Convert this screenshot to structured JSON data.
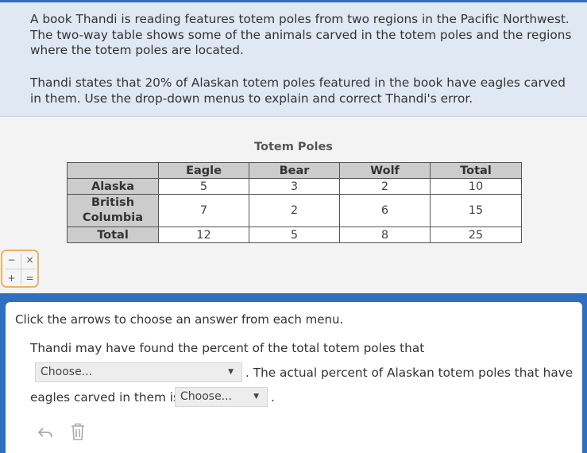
{
  "prompt": {
    "paragraph1": "A book Thandi is reading features totem poles from two regions in the Pacific Northwest. The two-way table shows some of the animals carved in the totem poles and the regions where the totem poles are located.",
    "paragraph2": "Thandi states that 20% of Alaskan totem poles featured in the book have eagles carved in them. Use the drop-down menus to explain and correct Thandi's error."
  },
  "table": {
    "title": "Totem Poles",
    "headers": [
      "Eagle",
      "Bear",
      "Wolf",
      "Total"
    ],
    "rows": [
      {
        "label": "Alaska",
        "values": [
          "5",
          "3",
          "2",
          "10"
        ]
      },
      {
        "label": "British Columbia",
        "values": [
          "7",
          "2",
          "6",
          "15"
        ]
      },
      {
        "label": "Total",
        "values": [
          "12",
          "5",
          "8",
          "25"
        ]
      }
    ]
  },
  "calculator": {
    "minus": "−",
    "times": "×",
    "plus": "+",
    "equals": "="
  },
  "answer": {
    "instructions": "Click the arrows to choose an answer from each menu.",
    "line1": "Thandi may have found the percent of the total totem poles that",
    "line2_suffix": ". The actual percent of Alaskan totem poles that have",
    "line3_prefix": "eagles carved in them is",
    "line3_suffix": ".",
    "dropdown1": {
      "selected": "Choose...",
      "arrow": "▼"
    },
    "dropdown2": {
      "selected": "Choose...",
      "arrow": "▼"
    }
  },
  "tools": {
    "undo_icon": "undo-icon",
    "delete_icon": "trash-icon"
  }
}
